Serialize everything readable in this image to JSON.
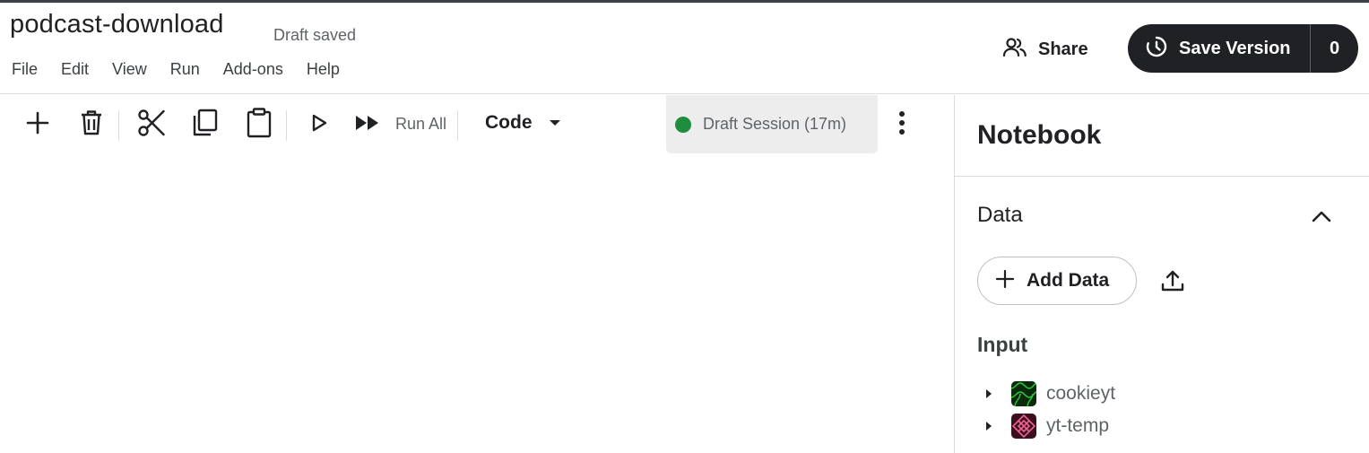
{
  "header": {
    "title": "podcast-download",
    "status": "Draft saved",
    "menu": [
      "File",
      "Edit",
      "View",
      "Run",
      "Add-ons",
      "Help"
    ],
    "share_label": "Share",
    "save_version_label": "Save Version",
    "save_version_count": "0"
  },
  "toolbar": {
    "icons": [
      "plus-icon",
      "trash-icon",
      "scissors-icon",
      "copy-icon",
      "clipboard-icon",
      "play-icon",
      "fast-forward-icon"
    ],
    "run_all_label": "Run All",
    "cell_type": "Code",
    "session_label": "Draft Session (17m)",
    "session_status_color": "#1e8e3e"
  },
  "panel": {
    "title": "Notebook",
    "data_section_title": "Data",
    "add_data_label": "Add Data",
    "input_title": "Input",
    "inputs": [
      {
        "name": "cookieyt",
        "thumb_color": "#0b2a0b",
        "accent": "#2ecc40"
      },
      {
        "name": "yt-temp",
        "thumb_color": "#3a0f1f",
        "accent": "#f06292"
      }
    ]
  }
}
